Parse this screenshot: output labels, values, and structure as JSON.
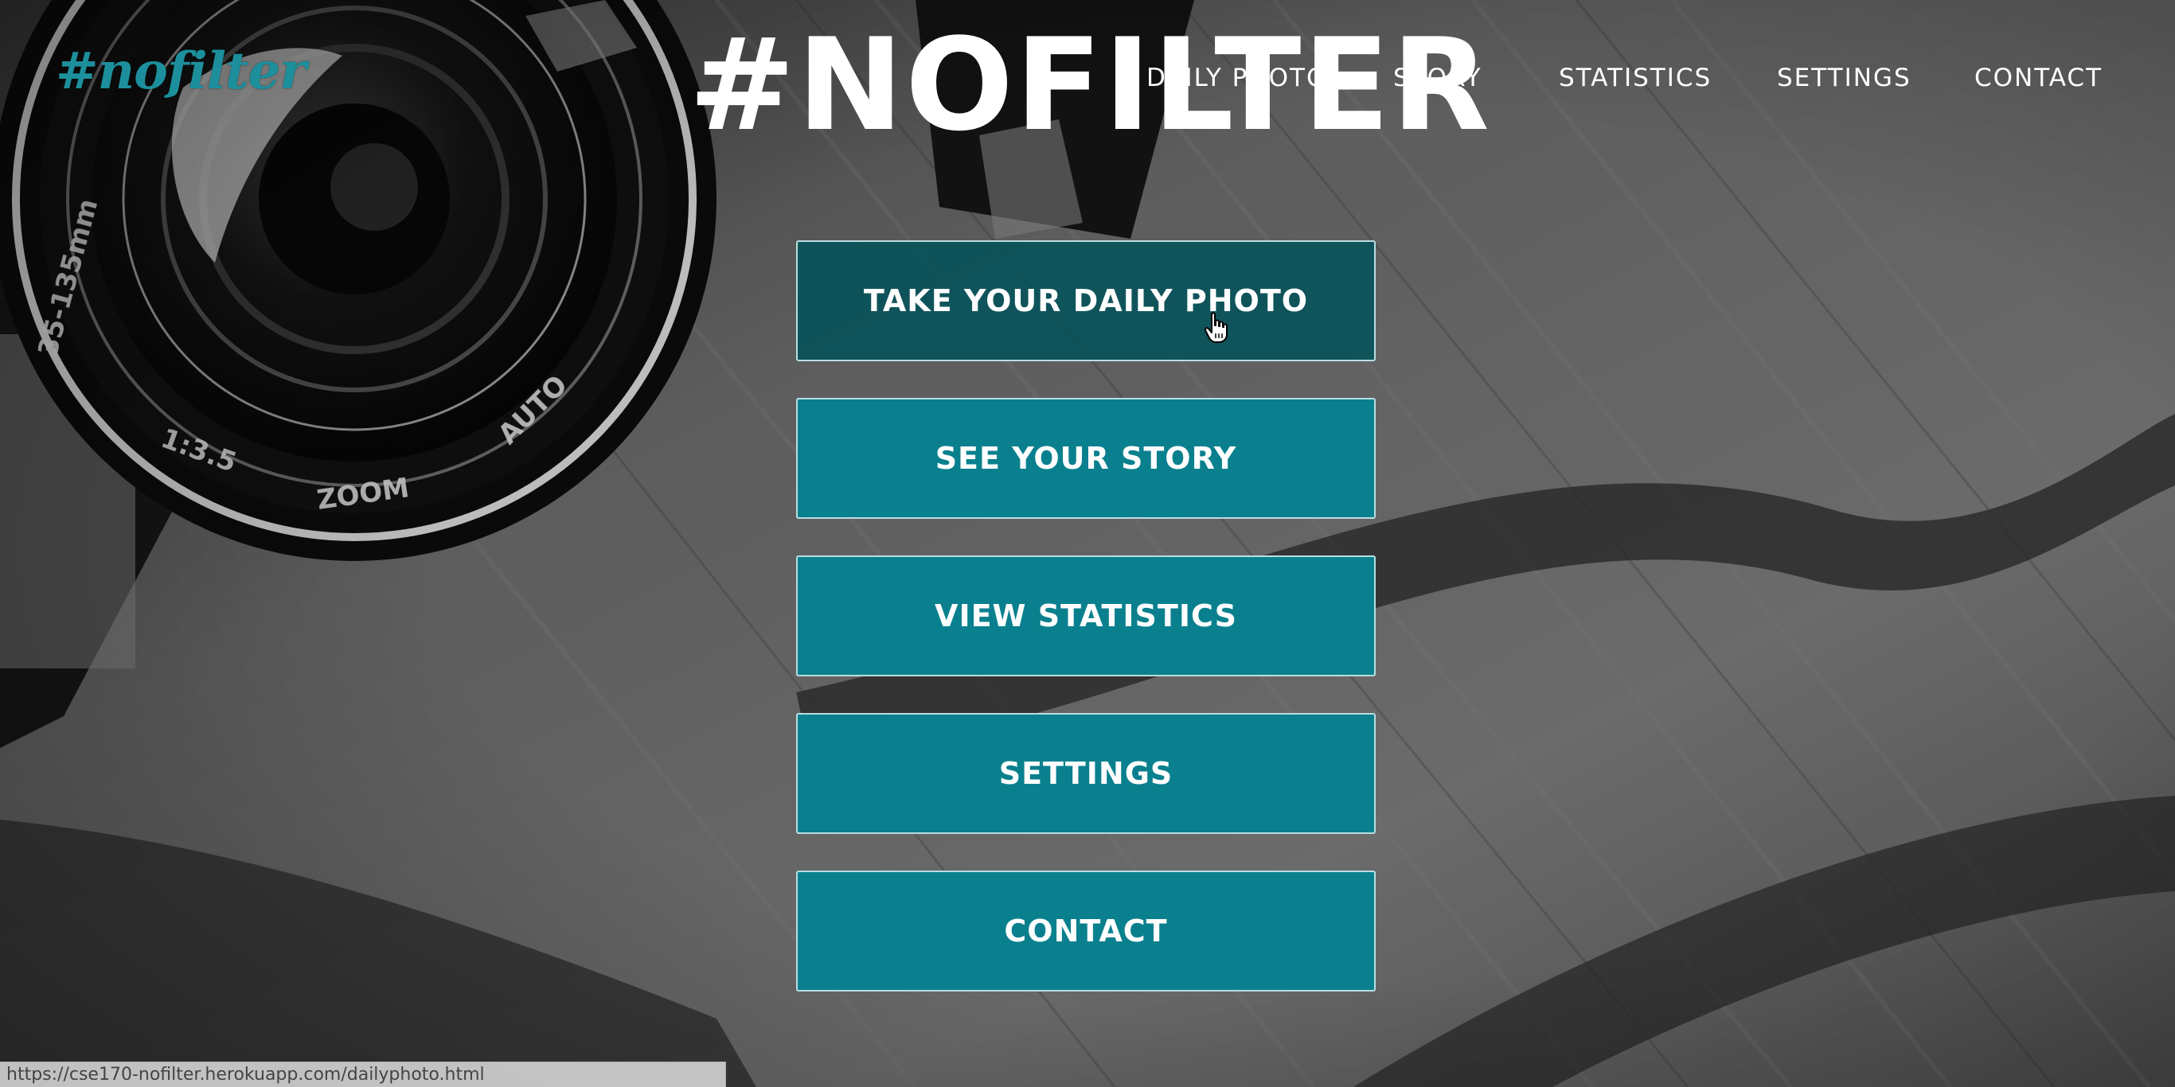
{
  "app": {
    "logo_text": "#nofilter",
    "page_title": "#NOFILTER"
  },
  "nav": {
    "items": [
      {
        "label": "DAILY PHOTO"
      },
      {
        "label": "STORY"
      },
      {
        "label": "STATISTICS"
      },
      {
        "label": "SETTINGS"
      },
      {
        "label": "CONTACT"
      }
    ]
  },
  "menu": {
    "buttons": [
      {
        "label": "TAKE YOUR DAILY PHOTO",
        "hovered": true
      },
      {
        "label": "SEE YOUR STORY"
      },
      {
        "label": "VIEW STATISTICS"
      },
      {
        "label": "SETTINGS"
      },
      {
        "label": "CONTACT"
      }
    ]
  },
  "status_bar": {
    "url": "https://cse170-nofilter.herokuapp.com/dailyphoto.html"
  },
  "colors": {
    "accent": "#0a808e",
    "accent_hover": "#04525a",
    "logo": "#1d8f9c",
    "title": "#ffffff"
  },
  "icons": {
    "cursor": "hand-pointer-icon"
  }
}
